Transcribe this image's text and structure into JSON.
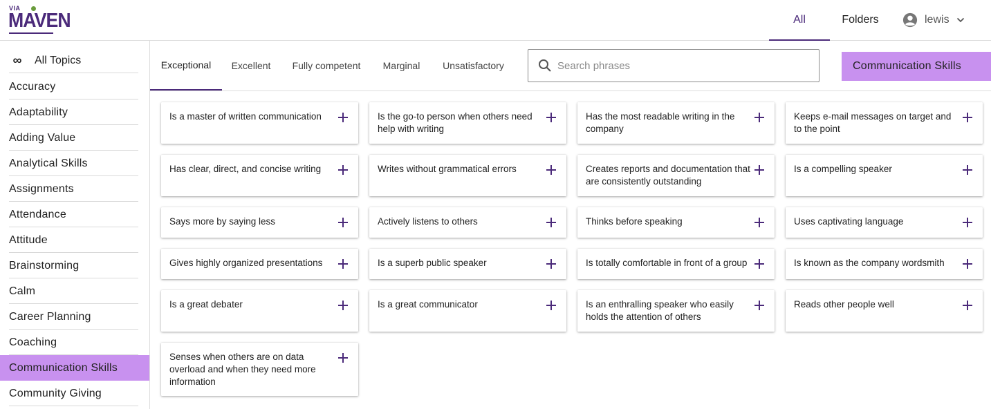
{
  "brand": {
    "via": "VIA",
    "name": "MAVEN"
  },
  "header": {
    "nav_all": "All",
    "nav_folders": "Folders",
    "user_name": "lewis"
  },
  "sidebar": {
    "all_topics": "All Topics",
    "topics": [
      "Accuracy",
      "Adaptability",
      "Adding Value",
      "Analytical Skills",
      "Assignments",
      "Attendance",
      "Attitude",
      "Brainstorming",
      "Calm",
      "Career Planning",
      "Coaching",
      "Communication Skills",
      "Community Giving"
    ],
    "active_index": 11
  },
  "tabs": [
    "Exceptional",
    "Excellent",
    "Fully competent",
    "Marginal",
    "Unsatisfactory"
  ],
  "active_tab": 0,
  "search": {
    "placeholder": "Search phrases",
    "value": ""
  },
  "category_button": "Communication Skills",
  "colors": {
    "accent": "#4b2a7a",
    "highlight": "#c891ef"
  },
  "phrases": [
    "Is a master of written communication",
    "Is the go-to person when others need help with writing",
    "Has the most readable writing in the company",
    "Keeps e-mail messages on target and to the point",
    "Has clear, direct, and concise writing",
    "Writes without grammatical errors",
    "Creates reports and documentation that are consistently outstanding",
    "Is a compelling speaker",
    "Says more by saying less",
    "Actively listens to others",
    "Thinks before speaking",
    "Uses captivating language",
    "Gives highly organized presentations",
    "Is a superb public speaker",
    "Is totally comfortable in front of a group",
    "Is known as the company wordsmith",
    "Is a great debater",
    "Is a great communicator",
    "Is an enthralling speaker who easily holds the attention of others",
    "Reads other people well",
    "Senses when others are on data overload and when they need more information"
  ]
}
